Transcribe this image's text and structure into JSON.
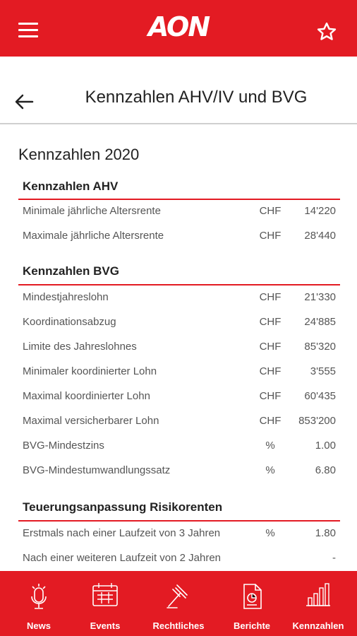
{
  "app": {
    "logo": "AON"
  },
  "header": {
    "menu_icon": "hamburger-menu-icon",
    "favorite_icon": "star-icon"
  },
  "page": {
    "title": "Kennzahlen AHV/IV und BVG",
    "back_icon": "arrow-left-icon"
  },
  "content": {
    "year_title": "Kennzahlen 2020",
    "sections": [
      {
        "heading": "Kennzahlen AHV",
        "rows": [
          {
            "label": "Minimale jährliche Altersrente",
            "unit": "CHF",
            "value": "14'220"
          },
          {
            "label": "Maximale jährliche Altersrente",
            "unit": "CHF",
            "value": "28'440"
          }
        ]
      },
      {
        "heading": "Kennzahlen BVG",
        "rows": [
          {
            "label": "Mindestjahreslohn",
            "unit": "CHF",
            "value": "21'330"
          },
          {
            "label": "Koordinationsabzug",
            "unit": "CHF",
            "value": "24'885"
          },
          {
            "label": "Limite des Jahreslohnes",
            "unit": "CHF",
            "value": "85'320"
          },
          {
            "label": "Minimaler koordinierter Lohn",
            "unit": "CHF",
            "value": "3'555"
          },
          {
            "label": "Maximal koordinierter Lohn",
            "unit": "CHF",
            "value": "60'435"
          },
          {
            "label": "Maximal versicherbarer Lohn",
            "unit": "CHF",
            "value": "853'200"
          },
          {
            "label": "BVG-Mindestzins",
            "unit": "%",
            "value": "1.00"
          },
          {
            "label": "BVG-Mindestumwandlungssatz",
            "unit": "%",
            "value": "6.80"
          }
        ]
      },
      {
        "heading": "Teuerungsanpassung Risikorenten",
        "rows": [
          {
            "label": "Erstmals nach einer Laufzeit von 3 Jahren",
            "unit": "%",
            "value": "1.80"
          },
          {
            "label": "Nach einer weiteren Laufzeit von 2 Jahren",
            "unit": "",
            "value": "-"
          }
        ]
      }
    ]
  },
  "bottom_nav": [
    {
      "label": "News",
      "icon": "microphone-icon"
    },
    {
      "label": "Events",
      "icon": "calendar-icon"
    },
    {
      "label": "Rechtliches",
      "icon": "gavel-icon"
    },
    {
      "label": "Berichte",
      "icon": "report-document-icon"
    },
    {
      "label": "Kennzahlen",
      "icon": "bar-chart-icon"
    }
  ],
  "colors": {
    "brand_red": "#e31b23",
    "text": "#222222",
    "muted_text": "#555555"
  }
}
